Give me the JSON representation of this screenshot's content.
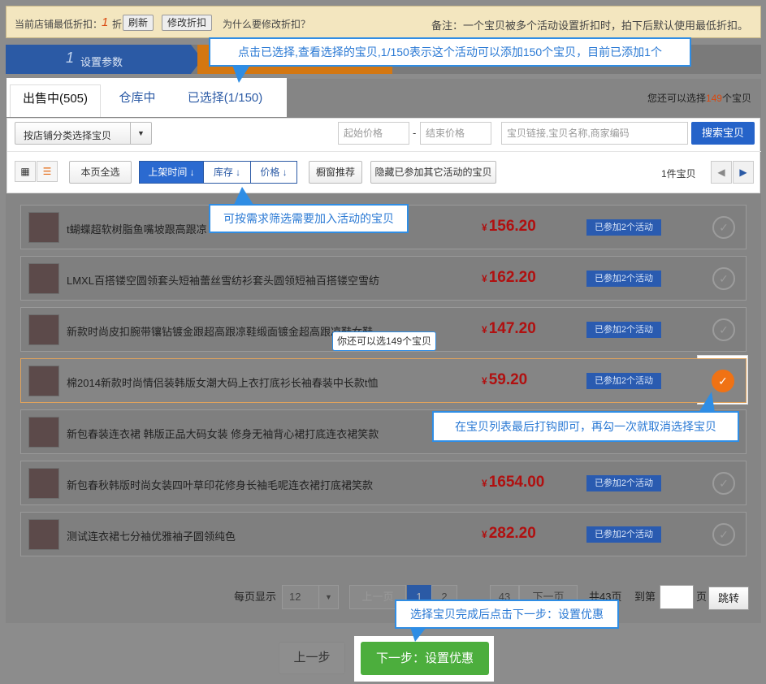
{
  "notice": {
    "min_discount_label": "当前店铺最低折扣：",
    "min_discount_value": "1",
    "min_discount_unit": "折",
    "refresh_button": "刷新",
    "modify_button": "修改折扣",
    "why_link": "为什么要修改折扣？",
    "remark": "备注：一个宝贝被多个活动设置折扣时，拍下后默认使用最低折扣。"
  },
  "steps": [
    {
      "num": "1",
      "label": "设置参数"
    }
  ],
  "tabs": [
    {
      "label": "出售中(505)",
      "active": true
    },
    {
      "label": "仓库中",
      "active": false
    },
    {
      "label": "已选择(1/150)",
      "active": false
    }
  ],
  "remaining": {
    "prefix": "您还可以选择",
    "count": "149",
    "suffix": "个宝贝"
  },
  "filters": {
    "category_select": "按店铺分类选择宝贝",
    "min_price_placeholder": "起始价格",
    "max_price_placeholder": "结束价格",
    "range_dash": "-",
    "search_placeholder": "宝贝链接,宝贝名称,商家编码",
    "search_button": "搜索宝贝",
    "select_all_button": "本页全选",
    "sort_options": [
      {
        "label": "上架时间 ↓",
        "active": true
      },
      {
        "label": "库存 ↓",
        "active": false
      },
      {
        "label": "价格 ↓",
        "active": false
      }
    ],
    "window_recommend_button": "橱窗推荐",
    "hide_joined_button": "隐藏已参加其它活动的宝贝",
    "item_count": "1件宝贝"
  },
  "products": [
    {
      "name": "t蝴蝶超软树脂鱼嘴坡跟高跟凉",
      "price": "156.20",
      "tag": "已参加2个活动",
      "selected": false
    },
    {
      "name": "LMXL百搭镂空圆领套头短袖蕾丝雪纺衫套头圆领短袖百搭镂空雪纺",
      "price": "162.20",
      "tag": "已参加2个活动",
      "selected": false
    },
    {
      "name": "新款时尚皮扣腕带镶钻镀金跟超高跟凉鞋缎面镀金超高跟凉鞋女鞋",
      "price": "147.20",
      "tag": "已参加2个活动",
      "selected": false
    },
    {
      "name": "棉2014新款时尚情侣装韩版女潮大码上衣打底衫长袖春装中长款t恤",
      "price": "59.20",
      "tag": "已参加2个活动",
      "selected": true
    },
    {
      "name": "新包春装连衣裙 韩版正品大码女装 修身无袖背心裙打底连衣裙笑款",
      "price": "",
      "tag": "",
      "selected": false
    },
    {
      "name": "新包春秋韩版时尚女装四叶草印花修身长袖毛呢连衣裙打底裙笑款",
      "price": "1654.00",
      "tag": "已参加2个活动",
      "selected": false
    },
    {
      "name": "测试连衣裙七分袖优雅袖子圆领纯色",
      "price": "282.20",
      "tag": "已参加2个活动",
      "selected": false
    }
  ],
  "currency": "¥",
  "pager": {
    "per_page_label": "每页显示",
    "per_page_value": "12",
    "prev": "上一页",
    "pages": [
      "1",
      "2"
    ],
    "last_page": "43",
    "next": "下一页",
    "total": "共43页",
    "goto_label": "到第",
    "page_unit": "页",
    "jump_button": "跳转"
  },
  "actions": {
    "prev_step": "上一步",
    "next_step": "下一步：设置优惠"
  },
  "callouts": {
    "tab_hint": "点击已选择,查看选择的宝贝,1/150表示这个活动可以添加150个宝贝，目前已添加1个",
    "filter_hint": "可按需求筛选需要加入活动的宝贝",
    "select_hint": "在宝贝列表最后打钩即可，再勾一次就取消选择宝贝",
    "next_hint": "选择宝贝完成后点击下一步：设置优惠",
    "row_tip": "你还可以选149个宝贝"
  }
}
